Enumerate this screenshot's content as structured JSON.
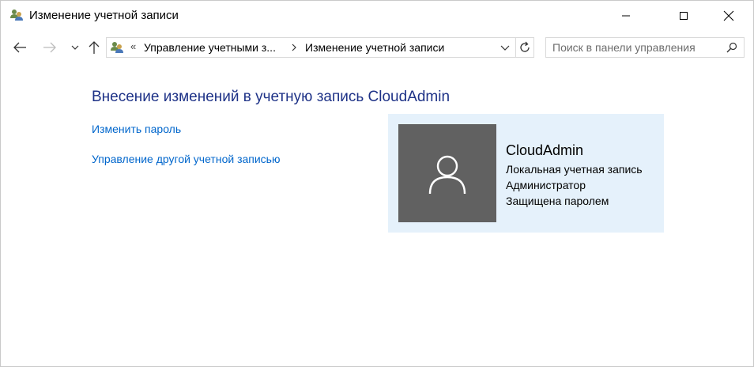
{
  "window": {
    "title": "Изменение учетной записи",
    "icon": "user-accounts-icon",
    "controls": [
      "minimize-icon",
      "maximize-icon",
      "close-icon"
    ]
  },
  "navigation": {
    "back_icon": "arrow-left-icon",
    "forward_icon": "arrow-right-icon",
    "recent_icon": "chevron-down-icon",
    "up_icon": "arrow-up-icon"
  },
  "address_bar": {
    "overflow": "«",
    "segments": [
      "Управление учетными з...",
      "Изменение учетной записи"
    ],
    "refresh_icon": "refresh-icon"
  },
  "search": {
    "placeholder": "Поиск в панели управления"
  },
  "main": {
    "title": "Внесение изменений в учетную запись CloudAdmin",
    "links": [
      "Изменить пароль",
      "Управление другой учетной записью"
    ]
  },
  "account": {
    "name": "CloudAdmin",
    "type": "Локальная учетная запись",
    "role": "Администратор",
    "protection": "Защищена паролем"
  },
  "colors": {
    "title_blue": "#1e3287",
    "link_blue": "#0066cc",
    "card_bg": "#e5f1fb",
    "avatar_bg": "#616161"
  }
}
